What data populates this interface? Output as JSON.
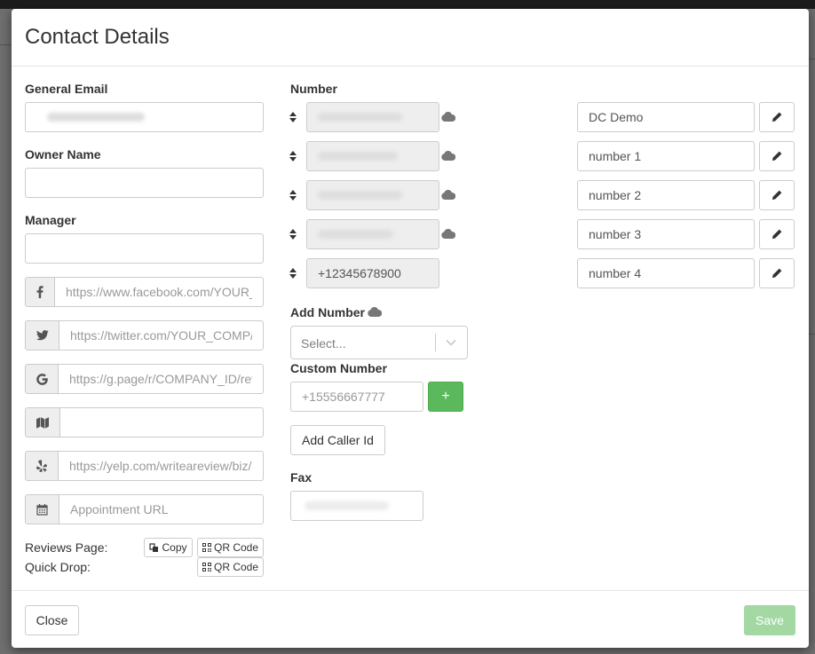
{
  "modal": {
    "title": "Contact Details",
    "general_email": {
      "label": "General Email",
      "value": ""
    },
    "owner_name": {
      "label": "Owner Name",
      "value": ""
    },
    "manager": {
      "label": "Manager",
      "value": ""
    },
    "social": {
      "facebook": {
        "icon": "facebook-icon",
        "placeholder": "https://www.facebook.com/YOUR_"
      },
      "twitter": {
        "icon": "twitter-icon",
        "placeholder": "https://twitter.com/YOUR_COMP/"
      },
      "google": {
        "icon": "google-icon",
        "placeholder": "https://g.page/r/COMPANY_ID/rev"
      },
      "map": {
        "icon": "map-icon",
        "placeholder": ""
      },
      "yelp": {
        "icon": "yelp-icon",
        "placeholder": "https://yelp.com/writeareview/biz/"
      },
      "appointment": {
        "icon": "calendar-icon",
        "placeholder": "Appointment URL"
      }
    },
    "reviews_page": {
      "label": "Reviews Page:",
      "copy_label": "Copy",
      "qr_label": "QR Code"
    },
    "quick_drop": {
      "label": "Quick Drop:",
      "qr_label": "QR Code"
    },
    "number": {
      "label": "Number",
      "rows": [
        {
          "value": "",
          "name": "DC Demo",
          "has_cloud": true
        },
        {
          "value": "",
          "name": "number 1",
          "has_cloud": true
        },
        {
          "value": "",
          "name": "number 2",
          "has_cloud": true
        },
        {
          "value": "",
          "name": "number 3",
          "has_cloud": true
        },
        {
          "value": "+12345678900",
          "name": "number 4",
          "has_cloud": false
        }
      ]
    },
    "add_number": {
      "label": "Add Number",
      "placeholder": "Select..."
    },
    "custom_number": {
      "label": "Custom Number",
      "placeholder": "+15556667777",
      "add_label": "+"
    },
    "add_caller_id_label": "Add Caller Id",
    "fax": {
      "label": "Fax",
      "value": ""
    },
    "footer": {
      "close_label": "Close",
      "save_label": "Save"
    },
    "colors": {
      "accent_green": "#5cb85c",
      "save_disabled": "#a3d8a3"
    }
  }
}
